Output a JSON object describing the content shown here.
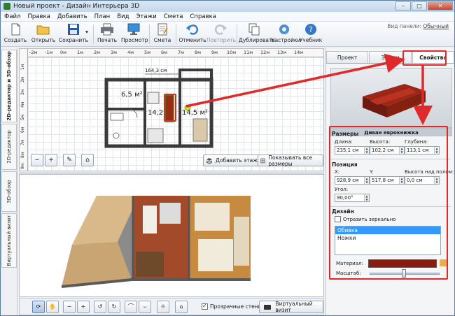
{
  "window": {
    "title": "Новый проект - Дизайн Интерьера 3D",
    "minimize": "–",
    "maximize": "□",
    "close": "✕"
  },
  "menu": [
    "Файл",
    "Правка",
    "Добавить",
    "План",
    "Вид",
    "Этажи",
    "Смета",
    "Справка"
  ],
  "toolbar": {
    "create": "Создать",
    "open": "Открыть",
    "save": "Сохранить",
    "print": "Печать",
    "preview": "Просмотр",
    "estimate": "Смета",
    "undo": "Отменить",
    "redo": "Повторить",
    "duplicate": "Дублировать",
    "settings": "Настройки",
    "tutorial": "Учебник",
    "panel_view_label": "Вид панели:",
    "panel_view_value": "Обычный"
  },
  "side_tabs": [
    "2D-редактор и 3D-обзор",
    "2D-редактор",
    "3D-обзор",
    "Виртуальный визит"
  ],
  "plan": {
    "ruler_h": [
      "-2м",
      "-1м",
      "0м",
      "1м",
      "2м",
      "3м",
      "4м",
      "5м",
      "6м",
      "7м",
      "8м",
      "9м",
      "10м",
      "11м",
      "12м",
      "13м",
      "14м"
    ],
    "ruler_v": [
      "1м",
      "2м",
      "3м",
      "4м",
      "5м",
      "6м",
      "7м",
      "8м",
      "9м"
    ],
    "dimension_label": "164,3 см",
    "rooms": [
      "6,5 м²",
      "14,2",
      "14,5 м²"
    ],
    "zoom_out": "−",
    "zoom_in": "+",
    "add_floor": "Добавить этаж",
    "show_all_dims": "Показывать все размеры"
  },
  "bottom": {
    "transparent_walls": "Прозрачные стены",
    "virtual_visit": "Виртуальный визит"
  },
  "props": {
    "tabs": [
      "Проект",
      "Этажи",
      "Свойства"
    ],
    "object_name": "Диван еврокнижка",
    "sizes": {
      "title": "Размеры",
      "length_label": "Длина:",
      "length": "235,1 см",
      "height_label": "Высота:",
      "height": "102,2 см",
      "depth_label": "Глубина:",
      "depth": "113,1 см"
    },
    "position": {
      "title": "Позиция",
      "x_label": "X:",
      "x": "928,9 см",
      "y_label": "Y:",
      "y": "517,8 см",
      "floor_label": "Высота над полом:",
      "floor": "0,0 см",
      "angle_label": "Угол:",
      "angle": "90,00°"
    },
    "design": {
      "title": "Дизайн",
      "mirror": "Отразить зеркально",
      "parts": [
        "Обивка",
        "Ножки"
      ],
      "material_label": "Материал:",
      "scale_label": "Масштаб:"
    }
  },
  "colors": {
    "accent_red": "#e02a2a",
    "upholstery": "#8b1a10",
    "selection": "#3399ff"
  }
}
